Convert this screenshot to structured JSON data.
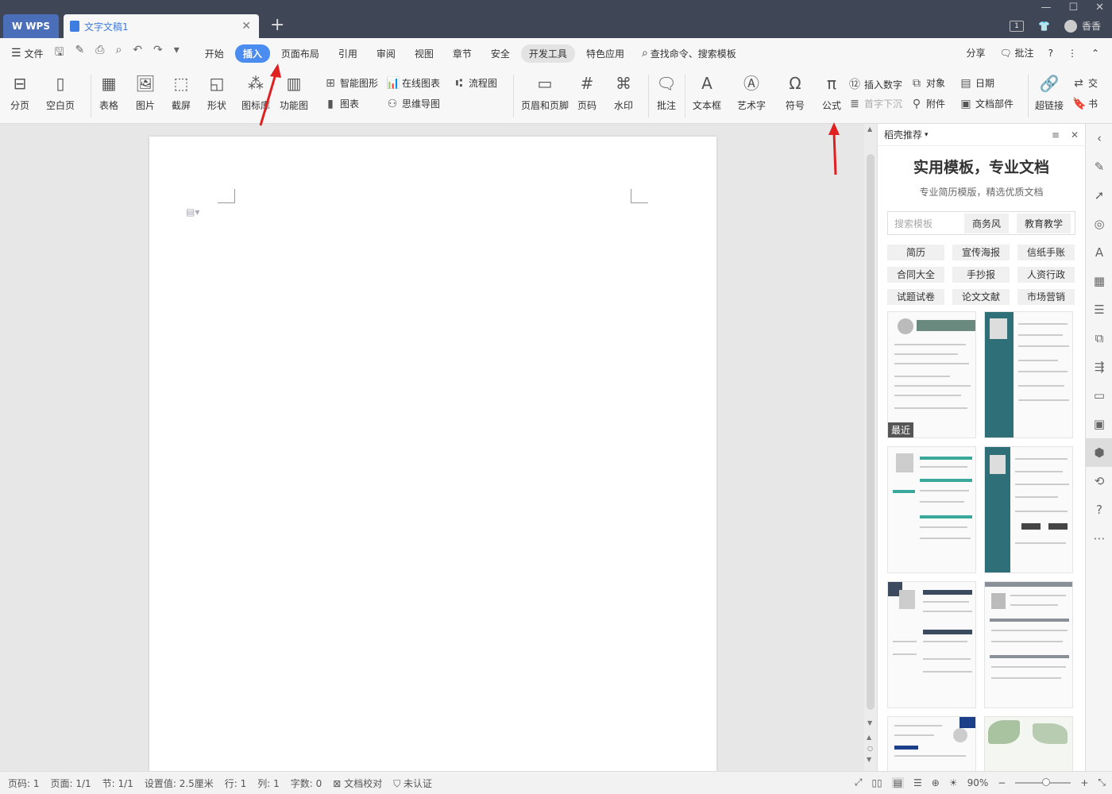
{
  "titlebar": {
    "app_tab": "WPS",
    "doc_tab": "文字文稿1",
    "user_name": "香香",
    "badge": "1"
  },
  "menubar": {
    "file": "文件",
    "tabs": [
      "开始",
      "插入",
      "页面布局",
      "引用",
      "审阅",
      "视图",
      "章节",
      "安全",
      "开发工具",
      "特色应用"
    ],
    "active_tab": "插入",
    "search": "查找命令、搜索模板",
    "share": "分享",
    "comment": "批注"
  },
  "ribbon": {
    "page_break": "分页",
    "blank_page": "空白页",
    "table": "表格",
    "picture": "图片",
    "screenshot": "截屏",
    "shape": "形状",
    "icon_lib": "图标库",
    "func_chart": "功能图",
    "smart_shape": "智能图形",
    "online_chart": "在线图表",
    "flowchart": "流程图",
    "chart": "图表",
    "mindmap": "思维导图",
    "header_footer": "页眉和页脚",
    "page_num": "页码",
    "watermark": "水印",
    "comment": "批注",
    "textbox": "文本框",
    "wordart": "艺术字",
    "symbol": "符号",
    "formula": "公式",
    "insert_number": "插入数字",
    "object": "对象",
    "date": "日期",
    "drop_cap": "首字下沉",
    "attachment": "附件",
    "doc_parts": "文档部件",
    "hyperlink": "超链接",
    "cross_ref": "交",
    "bookmark": "书"
  },
  "panel": {
    "title": "稻壳推荐",
    "headline": "实用模板，专业文档",
    "subline": "专业简历模版，精选优质文档",
    "search_placeholder": "搜索模板",
    "chips": [
      "商务风",
      "教育教学"
    ],
    "categories": [
      "简历",
      "宣传海报",
      "信纸手账",
      "合同大全",
      "手抄报",
      "人资行政",
      "试题试卷",
      "论文文献",
      "市场营销"
    ],
    "recent_label": "最近"
  },
  "status": {
    "page_num": "页码: 1",
    "pages": "页面: 1/1",
    "section": "节: 1/1",
    "setting": "设置值: 2.5厘米",
    "row": "行: 1",
    "col": "列: 1",
    "word_count": "字数: 0",
    "proof": "文档校对",
    "cert": "未认证",
    "zoom": "90%"
  },
  "colors": {
    "titlebar_bg": "#3f4656",
    "active_tab": "#4a8cf0",
    "annotation_arrow": "#e02020"
  }
}
